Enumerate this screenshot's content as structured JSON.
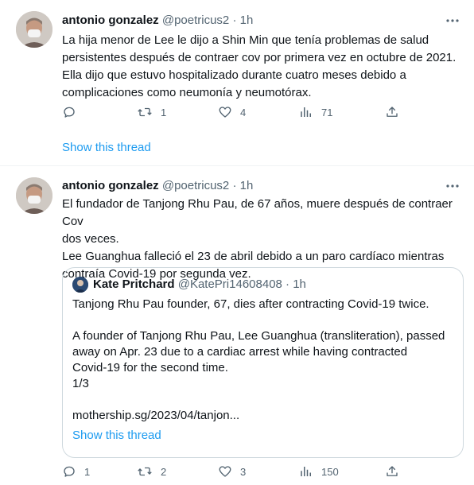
{
  "tweets": [
    {
      "author_name": "antonio gonzalez",
      "handle": "@poetricus2",
      "dot": "·",
      "time": "1h",
      "lines": [
        "La hija menor de Lee le dijo a Shin Min que tenía problemas de salud",
        "persistentes después de contraer cov por primera vez en octubre de 2021.",
        "Ella dijo que estuvo hospitalizado durante cuatro meses debido a",
        "complicaciones como neumonía y neumotórax."
      ],
      "replies": "",
      "retweets": "1",
      "likes": "4",
      "views": "71",
      "show_thread": "Show this thread"
    },
    {
      "author_name": "antonio gonzalez",
      "handle": "@poetricus2",
      "dot": "·",
      "time": "1h",
      "lines": [
        "El fundador de Tanjong Rhu Pau, de 67 años, muere después de contraer Cov",
        "dos veces.",
        "Lee Guanghua falleció el 23 de abril debido a un paro cardíaco mientras",
        "contraía Covid-19 por segunda vez."
      ],
      "quote": {
        "author_name": "Kate Pritchard",
        "handle": "@KatePri14608408",
        "dot": "·",
        "time": "1h",
        "lines": [
          "Tanjong Rhu Pau founder, 67, dies after contracting Covid-19 twice.",
          "A founder of Tanjong Rhu Pau, Lee Guanghua (transliteration), passed",
          "away on Apr. 23 due to a cardiac arrest while having contracted",
          "Covid-19 for the second time.",
          "1/3",
          "mothership.sg/2023/04/tanjon..."
        ],
        "show_thread": "Show this thread"
      },
      "replies": "1",
      "retweets": "2",
      "likes": "3",
      "views": "150"
    }
  ],
  "icons": {
    "reply": "reply-icon",
    "retweet": "retweet-icon",
    "like": "heart-icon",
    "views": "views-icon",
    "share": "share-icon",
    "more": "more-icon"
  },
  "colors": {
    "link": "#1d9bf0",
    "secondary_text": "#536471",
    "primary_text": "#0f1419",
    "border": "#cfd9de"
  }
}
